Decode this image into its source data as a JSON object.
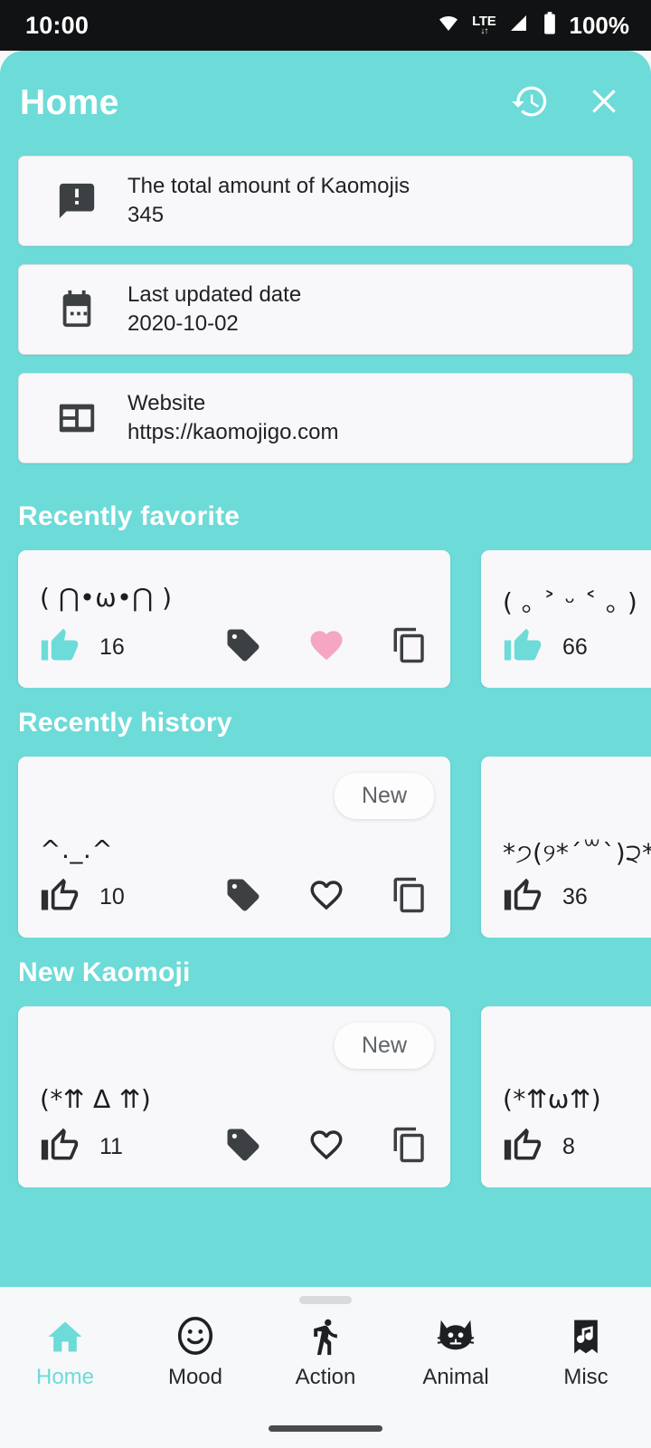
{
  "statusbar": {
    "time": "10:00",
    "network_type": "LTE",
    "network_arrows": "↓↑",
    "battery_percent": "100%",
    "icons": [
      "wifi-icon",
      "lte-icon",
      "signal-icon",
      "battery-icon"
    ]
  },
  "header": {
    "title": "Home",
    "history_icon": "history-icon",
    "close_icon": "close-icon"
  },
  "theme": {
    "accent": "#6DDBD8",
    "card_bg": "#F8F8FA",
    "heart_filled": "#F4A5C0",
    "text": "#202124"
  },
  "info_cards": [
    {
      "icon": "announcement-icon",
      "label": "The total amount of Kaomojis",
      "value": "345"
    },
    {
      "icon": "calendar-icon",
      "label": "Last updated date",
      "value": "2020-10-02"
    },
    {
      "icon": "website-icon",
      "label": "Website",
      "value": "https://kaomojigo.com"
    }
  ],
  "sections": [
    {
      "title": "Recently favorite",
      "card_height": "short",
      "cards": [
        {
          "face": "( ⋂•ω•⋂ )",
          "likes": "16",
          "badge": null,
          "liked": true,
          "favorited": true,
          "show_actions": true
        },
        {
          "face": "( ｡ ˃ ᵕ ˂ ｡ )",
          "likes": "66",
          "badge": null,
          "liked": true,
          "favorited": false,
          "show_actions": false
        }
      ]
    },
    {
      "title": "Recently history",
      "card_height": "tall",
      "cards": [
        {
          "face": "^._.^",
          "likes": "10",
          "badge": "New",
          "liked": false,
          "favorited": false,
          "show_actions": true
        },
        {
          "face": "*੭(୨*´꒳`)੨*",
          "likes": "36",
          "badge": null,
          "liked": false,
          "favorited": false,
          "show_actions": false
        }
      ]
    },
    {
      "title": "New Kaomoji",
      "card_height": "tall",
      "cards": [
        {
          "face": "(*⇈ ∆ ⇈)",
          "likes": "11",
          "badge": "New",
          "liked": false,
          "favorited": false,
          "show_actions": true
        },
        {
          "face": "(*⇈ω⇈)",
          "likes": "8",
          "badge": null,
          "liked": false,
          "favorited": false,
          "show_actions": false
        }
      ]
    }
  ],
  "card_action_icons": {
    "like": "thumb-up-icon",
    "tag": "tag-icon",
    "favorite": "heart-icon",
    "copy": "copy-icon"
  },
  "bottomnav": {
    "items": [
      {
        "label": "Home",
        "icon": "home-icon",
        "active": true
      },
      {
        "label": "Mood",
        "icon": "mood-icon",
        "active": false
      },
      {
        "label": "Action",
        "icon": "action-icon",
        "active": false
      },
      {
        "label": "Animal",
        "icon": "animal-icon",
        "active": false
      },
      {
        "label": "Misc",
        "icon": "misc-icon",
        "active": false
      }
    ]
  }
}
